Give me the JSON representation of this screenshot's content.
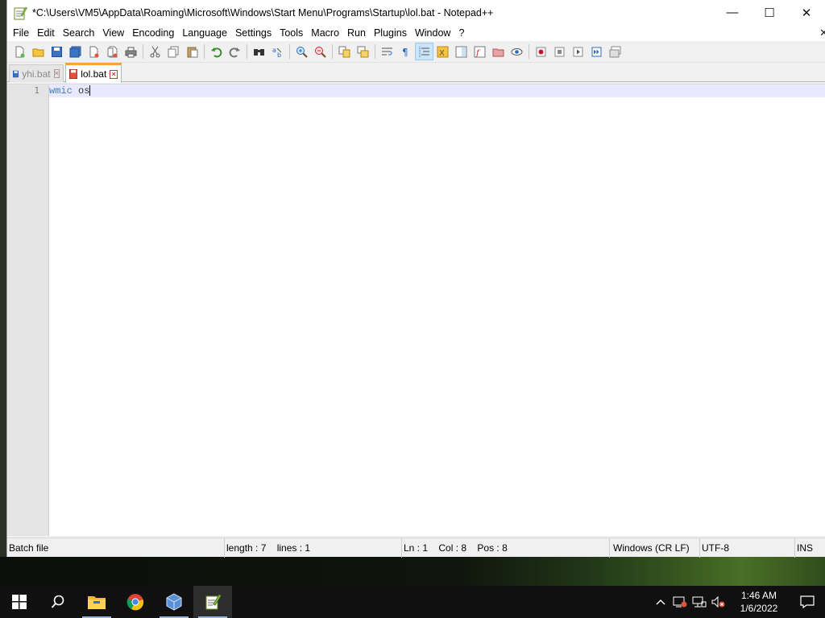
{
  "window": {
    "title": "*C:\\Users\\VM5\\AppData\\Roaming\\Microsoft\\Windows\\Start Menu\\Programs\\Startup\\lol.bat - Notepad++",
    "minimize_glyph": "—",
    "maximize_glyph": "☐",
    "close_glyph": "✕"
  },
  "menu": {
    "items": [
      "File",
      "Edit",
      "Search",
      "View",
      "Encoding",
      "Language",
      "Settings",
      "Tools",
      "Macro",
      "Run",
      "Plugins",
      "Window",
      "?"
    ],
    "close_glyph": "✕"
  },
  "toolbar": {
    "icons": [
      "new-file-icon",
      "open-file-icon",
      "save-icon",
      "save-all-icon",
      "close-icon",
      "close-all-icon",
      "print-icon",
      "cut-icon",
      "copy-icon",
      "paste-icon",
      "undo-icon",
      "redo-icon",
      "find-icon",
      "replace-icon",
      "zoom-in-icon",
      "zoom-out-icon",
      "sync-vertical-icon",
      "sync-horizontal-icon",
      "word-wrap-icon",
      "show-all-characters-icon",
      "indent-guide-icon",
      "user-language-icon",
      "document-map-icon",
      "function-list-icon",
      "folder-as-workspace-icon",
      "monitoring-icon",
      "record-macro-icon",
      "stop-macro-icon",
      "play-macro-icon",
      "run-macro-multiple-icon",
      "save-macro-icon"
    ]
  },
  "tabs": [
    {
      "label": "yhi.bat",
      "active": false,
      "saved": true
    },
    {
      "label": "lol.bat",
      "active": true,
      "saved": false
    }
  ],
  "editor": {
    "line_number": "1",
    "code_keyword": "wmic",
    "code_rest": " os"
  },
  "statusbar": {
    "file_type": "Batch file",
    "length": "length : 7",
    "lines": "lines : 1",
    "ln": "Ln : 1",
    "col": "Col : 8",
    "pos": "Pos : 8",
    "eol": "Windows (CR LF)",
    "encoding": "UTF-8",
    "mode": "INS"
  },
  "taskbar": {
    "apps": [
      "file-explorer-icon",
      "chrome-icon",
      "virtualbox-icon",
      "notepadpp-icon"
    ],
    "clock_time": "1:46 AM",
    "clock_date": "1/6/2022"
  },
  "colors": {
    "tab_accent": "#f9a33b",
    "keyword": "#3a7fc2",
    "current_line": "#e8e8ff",
    "taskbar": "#101010"
  }
}
